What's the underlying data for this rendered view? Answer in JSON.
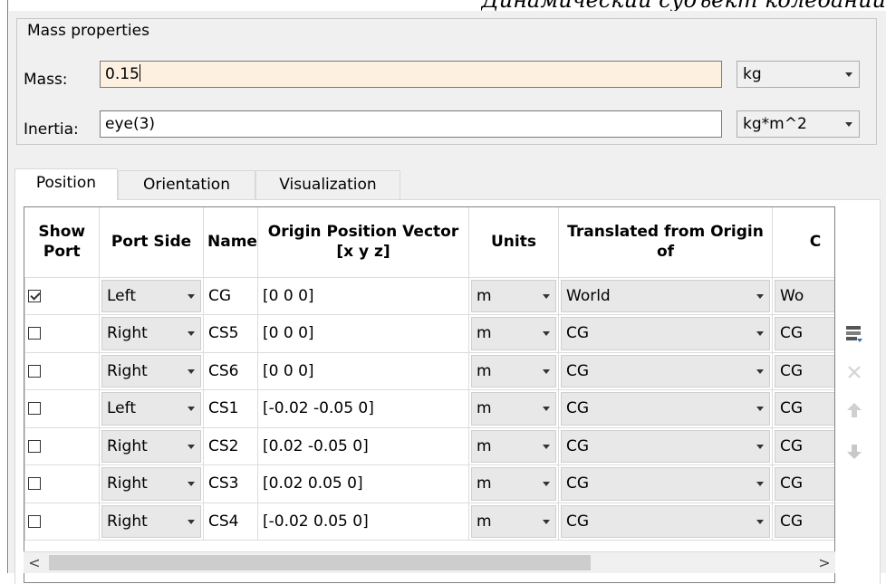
{
  "caption": "Динамический субъект колебаний",
  "mass_properties": {
    "title": "Mass properties",
    "mass_label": "Mass:",
    "mass_value": "0.15",
    "mass_unit": "kg",
    "inertia_label": "Inertia:",
    "inertia_value": "eye(3)",
    "inertia_unit": "kg*m^2"
  },
  "tabs": [
    {
      "label": "Position",
      "selected": true
    },
    {
      "label": "Orientation",
      "selected": false
    },
    {
      "label": "Visualization",
      "selected": false
    }
  ],
  "table": {
    "headers": [
      "Show Port",
      "Port Side",
      "Name",
      "Origin Position Vector [x y z]",
      "Units",
      "Translated from Origin of",
      "C"
    ],
    "rows": [
      {
        "show": true,
        "side": "Left",
        "name": "CG",
        "vector": "[0 0 0]",
        "units": "m",
        "from": "World",
        "extra": "Wo"
      },
      {
        "show": false,
        "side": "Right",
        "name": "CS5",
        "vector": "[0 0 0]",
        "units": "m",
        "from": "CG",
        "extra": "CG"
      },
      {
        "show": false,
        "side": "Right",
        "name": "CS6",
        "vector": "[0 0 0]",
        "units": "m",
        "from": "CG",
        "extra": "CG"
      },
      {
        "show": false,
        "side": "Left",
        "name": "CS1",
        "vector": "[-0.02 -0.05 0]",
        "units": "m",
        "from": "CG",
        "extra": "CG"
      },
      {
        "show": false,
        "side": "Right",
        "name": "CS2",
        "vector": "[0.02 -0.05 0]",
        "units": "m",
        "from": "CG",
        "extra": "CG"
      },
      {
        "show": false,
        "side": "Right",
        "name": "CS3",
        "vector": "[0.02 0.05 0]",
        "units": "m",
        "from": "CG",
        "extra": "CG"
      },
      {
        "show": false,
        "side": "Right",
        "name": "CS4",
        "vector": "[-0.02 0.05 0]",
        "units": "m",
        "from": "CG",
        "extra": "CG"
      }
    ]
  },
  "scrollbar": {
    "left_arrow": "<",
    "right_arrow": ">"
  },
  "side_buttons": [
    {
      "icon": "add-row-icon",
      "enabled": true
    },
    {
      "icon": "delete-x-icon",
      "enabled": false
    },
    {
      "icon": "arrow-up-icon",
      "enabled": false
    },
    {
      "icon": "arrow-down-icon",
      "enabled": false
    }
  ]
}
